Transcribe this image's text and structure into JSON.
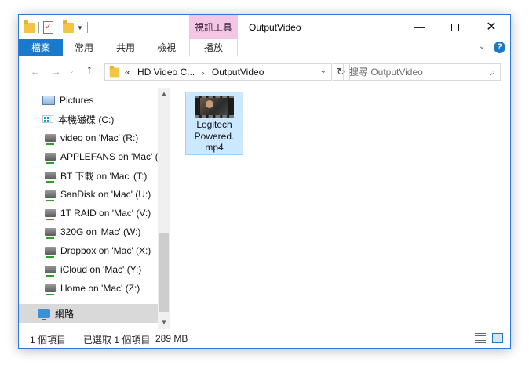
{
  "window": {
    "title": "OutputVideo",
    "context_tab_group": "視訊工具",
    "controls": {
      "minimize": "—",
      "close": "✕"
    }
  },
  "ribbon": {
    "tabs": {
      "file": "檔案",
      "home": "常用",
      "share": "共用",
      "view": "檢視",
      "play": "播放"
    },
    "collapse": "⌄",
    "help": "?"
  },
  "nav": {
    "back": "←",
    "forward": "→",
    "recent": "⌄",
    "up": "↑",
    "crumbs": {
      "prefix": "«",
      "parent": "HD Video C...",
      "separator": "›",
      "current": "OutputVideo"
    },
    "address_dropdown": "⌄",
    "refresh": "↻",
    "search_placeholder": "搜尋 OutputVideo",
    "search_icon": "⌕"
  },
  "tree": [
    {
      "label": "Pictures",
      "icon": "pictures-icon"
    },
    {
      "label": "本機磁碟 (C:)",
      "icon": "local-disk-icon"
    },
    {
      "label": "video on 'Mac' (R:)",
      "icon": "network-drive-icon"
    },
    {
      "label": "APPLEFANS on 'Mac' (",
      "icon": "network-drive-icon"
    },
    {
      "label": "BT 下載 on 'Mac' (T:)",
      "icon": "network-drive-icon"
    },
    {
      "label": "SanDisk on 'Mac' (U:)",
      "icon": "network-drive-icon"
    },
    {
      "label": "1T RAID on 'Mac' (V:)",
      "icon": "network-drive-icon"
    },
    {
      "label": "320G on 'Mac' (W:)",
      "icon": "network-drive-icon"
    },
    {
      "label": "Dropbox on 'Mac' (X:)",
      "icon": "network-drive-icon"
    },
    {
      "label": "iCloud on 'Mac' (Y:)",
      "icon": "network-drive-icon"
    },
    {
      "label": "Home on 'Mac' (Z:)",
      "icon": "network-drive-icon"
    },
    {
      "label": "網路",
      "icon": "network-icon"
    }
  ],
  "scroll": {
    "up": "▲",
    "down": "▼"
  },
  "file": {
    "name_line1": "Logitech",
    "name_line2": "Powered.",
    "name_line3": "mp4",
    "icon": "video-thumbnail-icon"
  },
  "status": {
    "count": "1 個項目",
    "selected": "已選取 1 個項目",
    "size": "289 MB"
  }
}
